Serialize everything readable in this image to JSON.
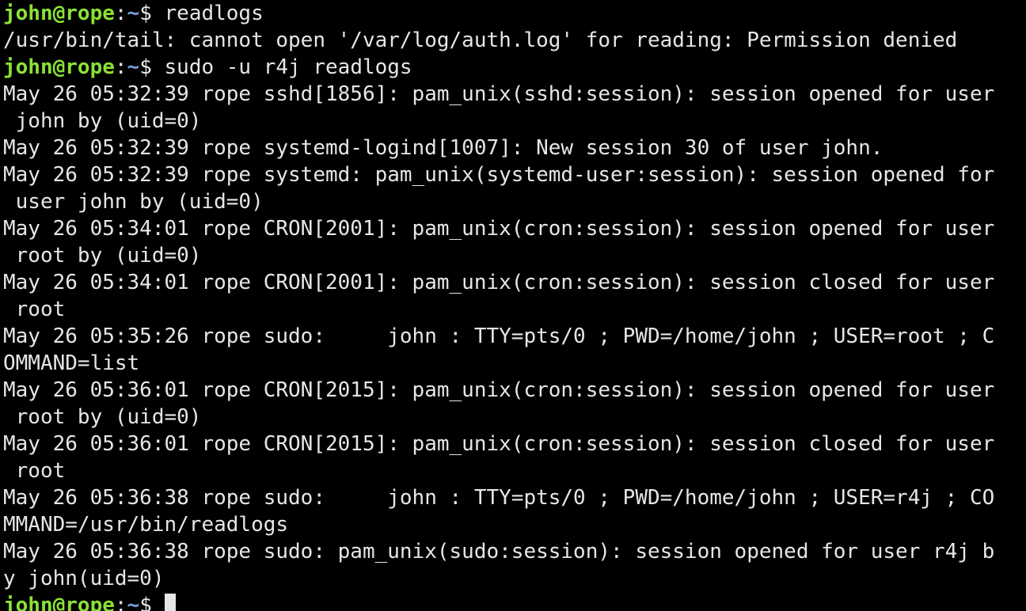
{
  "colors": {
    "background": "#000000",
    "foreground": "#e6e6e6",
    "prompt_user": "#8ae234",
    "prompt_path": "#729fcf"
  },
  "prompt": {
    "user_host": "john@rope",
    "colon": ":",
    "path": "~",
    "symbol": "$ "
  },
  "commands": {
    "first": "readlogs",
    "second": "sudo -u r4j readlogs"
  },
  "output": {
    "error": "/usr/bin/tail: cannot open '/var/log/auth.log' for reading: Permission denied",
    "log_lines": [
      "May 26 05:32:39 rope sshd[1856]: pam_unix(sshd:session): session opened for user",
      " john by (uid=0)",
      "May 26 05:32:39 rope systemd-logind[1007]: New session 30 of user john.",
      "May 26 05:32:39 rope systemd: pam_unix(systemd-user:session): session opened for",
      " user john by (uid=0)",
      "May 26 05:34:01 rope CRON[2001]: pam_unix(cron:session): session opened for user",
      " root by (uid=0)",
      "May 26 05:34:01 rope CRON[2001]: pam_unix(cron:session): session closed for user",
      " root",
      "May 26 05:35:26 rope sudo:     john : TTY=pts/0 ; PWD=/home/john ; USER=root ; C",
      "OMMAND=list",
      "May 26 05:36:01 rope CRON[2015]: pam_unix(cron:session): session opened for user",
      " root by (uid=0)",
      "May 26 05:36:01 rope CRON[2015]: pam_unix(cron:session): session closed for user",
      " root",
      "May 26 05:36:38 rope sudo:     john : TTY=pts/0 ; PWD=/home/john ; USER=r4j ; CO",
      "MMAND=/usr/bin/readlogs",
      "May 26 05:36:38 rope sudo: pam_unix(sudo:session): session opened for user r4j b",
      "y john(uid=0)"
    ]
  }
}
